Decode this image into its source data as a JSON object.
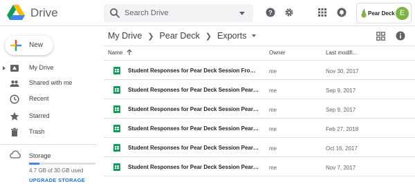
{
  "app": {
    "title": "Drive"
  },
  "search": {
    "placeholder": "Search Drive"
  },
  "account": {
    "org_name": "Pear Deck",
    "avatar_letter": "E"
  },
  "sidebar": {
    "new_label": "New",
    "items": [
      {
        "label": "My Drive",
        "icon": "my-drive-icon"
      },
      {
        "label": "Shared with me",
        "icon": "people-icon"
      },
      {
        "label": "Recent",
        "icon": "clock-icon"
      },
      {
        "label": "Starred",
        "icon": "star-icon"
      },
      {
        "label": "Trash",
        "icon": "trash-icon"
      }
    ],
    "storage": {
      "label": "Storage",
      "used_text": "4.7 GB of 30 GB used",
      "used_fraction": 0.157,
      "upgrade_label": "UPGRADE STORAGE"
    }
  },
  "breadcrumb": {
    "items": [
      "My Drive",
      "Pear Deck",
      "Exports"
    ]
  },
  "columns": {
    "name": "Name",
    "owner": "Owner",
    "modified": "Last modifi..."
  },
  "files": [
    {
      "name": "Student Responses for Pear Deck Session From Gslide...",
      "owner": "me",
      "modified": "Nov 30, 2017"
    },
    {
      "name": "Student Responses for Pear Deck Session Pear Deck In...",
      "owner": "me",
      "modified": "Sep 9, 2017"
    },
    {
      "name": "Student Responses for Pear Deck Session Pear Deck In...",
      "owner": "me",
      "modified": "Sep 9, 2017"
    },
    {
      "name": "Student Responses for Pear Deck Session Pear Deck In...",
      "owner": "me",
      "modified": "Feb 27, 2018"
    },
    {
      "name": "Student Responses for Pear Deck Session Pear Deck In...",
      "owner": "me",
      "modified": "Oct 16, 2017"
    },
    {
      "name": "Student Responses for Pear Deck Session Pear Deck In...",
      "owner": "me",
      "modified": "Nov 7, 2017"
    }
  ],
  "colors": {
    "accent": "#1a73e8",
    "sheets_green": "#0f9d58",
    "storage_bar": "#4285f4",
    "avatar_bg": "#7cb342"
  }
}
